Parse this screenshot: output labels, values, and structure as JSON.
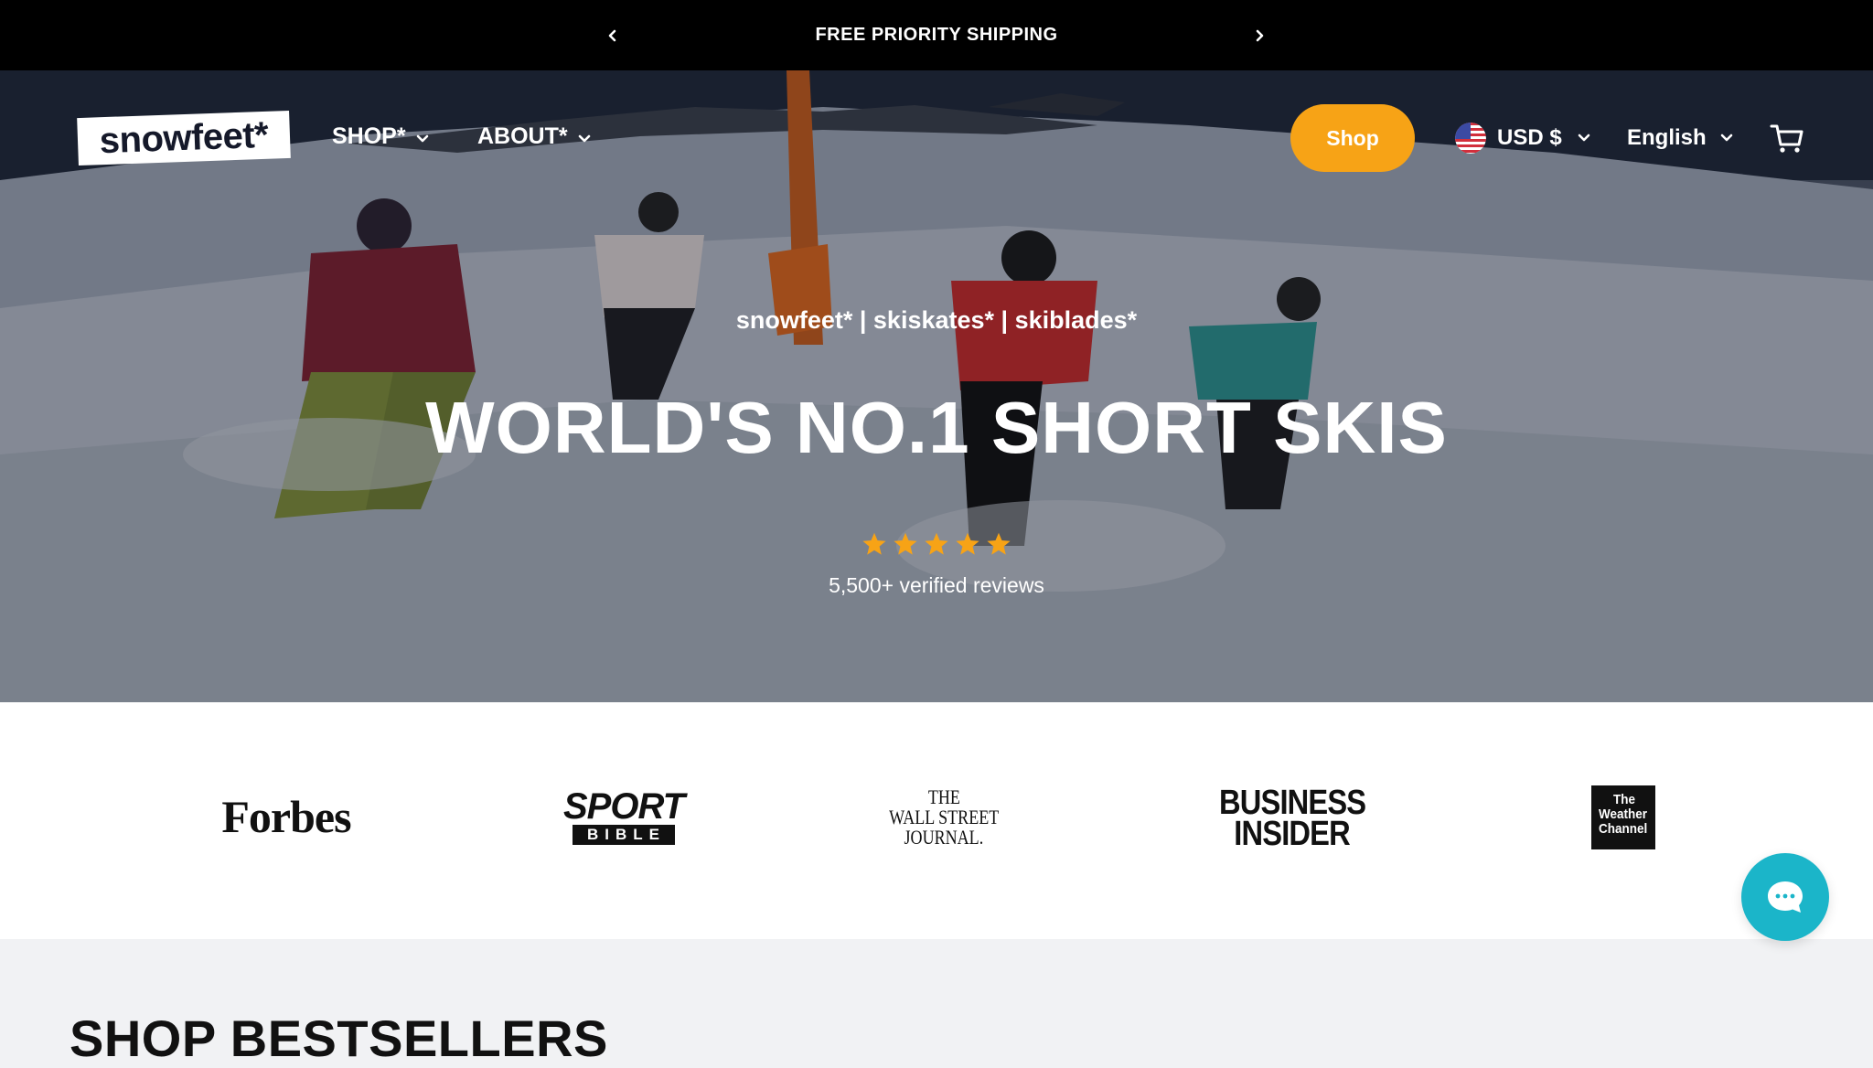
{
  "announcement": {
    "text": "FREE PRIORITY SHIPPING",
    "prev_icon": "chevron-left-icon",
    "next_icon": "chevron-right-icon"
  },
  "header": {
    "logo_text": "snowfeet*",
    "nav": [
      {
        "label": "SHOP*",
        "icon": "chevron-down-icon"
      },
      {
        "label": "ABOUT*",
        "icon": "chevron-down-icon"
      }
    ],
    "shop_button": "Shop",
    "currency": {
      "label": "USD $",
      "flag": "us-flag-icon"
    },
    "language": "English",
    "cart_icon": "cart-icon"
  },
  "hero": {
    "subtitle": "snowfeet* | skiskates* | skiblades*",
    "title": "WORLD'S NO.1 SHORT SKIS",
    "rating": 5,
    "reviews": "5,500+ verified reviews"
  },
  "press": {
    "forbes": "Forbes",
    "sport_bible": {
      "top": "SPORT",
      "bottom": "BIBLE"
    },
    "wsj": [
      "THE",
      "WALL STREET",
      "JOURNAL."
    ],
    "business_insider": [
      "BUSINESS",
      "INSIDER"
    ],
    "weather_channel": [
      "The",
      "Weather",
      "Channel"
    ]
  },
  "bestsellers": {
    "heading": "SHOP BESTSELLERS"
  },
  "colors": {
    "accent": "#f7a316",
    "chat": "#1bb5c9",
    "announcement_bg": "#000000"
  }
}
